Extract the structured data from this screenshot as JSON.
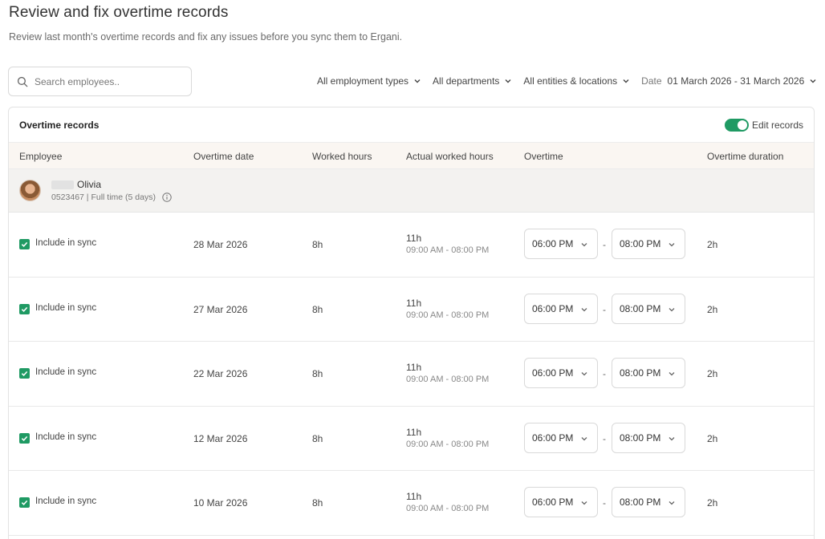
{
  "page": {
    "title": "Review and fix overtime records",
    "subtitle": "Review last month's overtime records and fix any issues before you sync them to Ergani."
  },
  "search": {
    "placeholder": "Search employees.."
  },
  "filters": {
    "employment_types": "All employment types",
    "departments": "All departments",
    "entities": "All entities & locations",
    "date_label": "Date",
    "date_value": "01 March 2026 - 31 March 2026"
  },
  "card": {
    "title": "Overtime records",
    "edit_toggle_label": "Edit records",
    "edit_toggle_on": true
  },
  "columns": {
    "employee": "Employee",
    "overtime_date": "Overtime date",
    "worked_hours": "Worked hours",
    "actual_worked_hours": "Actual worked hours",
    "overtime": "Overtime",
    "overtime_duration": "Overtime duration"
  },
  "employee": {
    "name": "Olivia",
    "meta": "0523467 | Full time (5 days)"
  },
  "rows": [
    {
      "include_label": "Include in sync",
      "checked": true,
      "date": "28 Mar 2026",
      "worked": "8h",
      "actual": "11h",
      "actual_range": "09:00 AM - 08:00 PM",
      "start": "06:00 PM",
      "separator": "-",
      "end": "08:00 PM",
      "duration": "2h"
    },
    {
      "include_label": "Include in sync",
      "checked": true,
      "date": "27 Mar 2026",
      "worked": "8h",
      "actual": "11h",
      "actual_range": "09:00 AM - 08:00 PM",
      "start": "06:00 PM",
      "separator": "-",
      "end": "08:00 PM",
      "duration": "2h"
    },
    {
      "include_label": "Include in sync",
      "checked": true,
      "date": "22 Mar 2026",
      "worked": "8h",
      "actual": "11h",
      "actual_range": "09:00 AM - 08:00 PM",
      "start": "06:00 PM",
      "separator": "-",
      "end": "08:00 PM",
      "duration": "2h"
    },
    {
      "include_label": "Include in sync",
      "checked": true,
      "date": "12 Mar 2026",
      "worked": "8h",
      "actual": "11h",
      "actual_range": "09:00 AM - 08:00 PM",
      "start": "06:00 PM",
      "separator": "-",
      "end": "08:00 PM",
      "duration": "2h"
    },
    {
      "include_label": "Include in sync",
      "checked": true,
      "date": "10 Mar 2026",
      "worked": "8h",
      "actual": "11h",
      "actual_range": "09:00 AM - 08:00 PM",
      "start": "06:00 PM",
      "separator": "-",
      "end": "08:00 PM",
      "duration": "2h"
    }
  ],
  "colors": {
    "accent": "#1f9a63",
    "header_bg": "#faf6f2",
    "group_bg": "#f3f2f0"
  }
}
